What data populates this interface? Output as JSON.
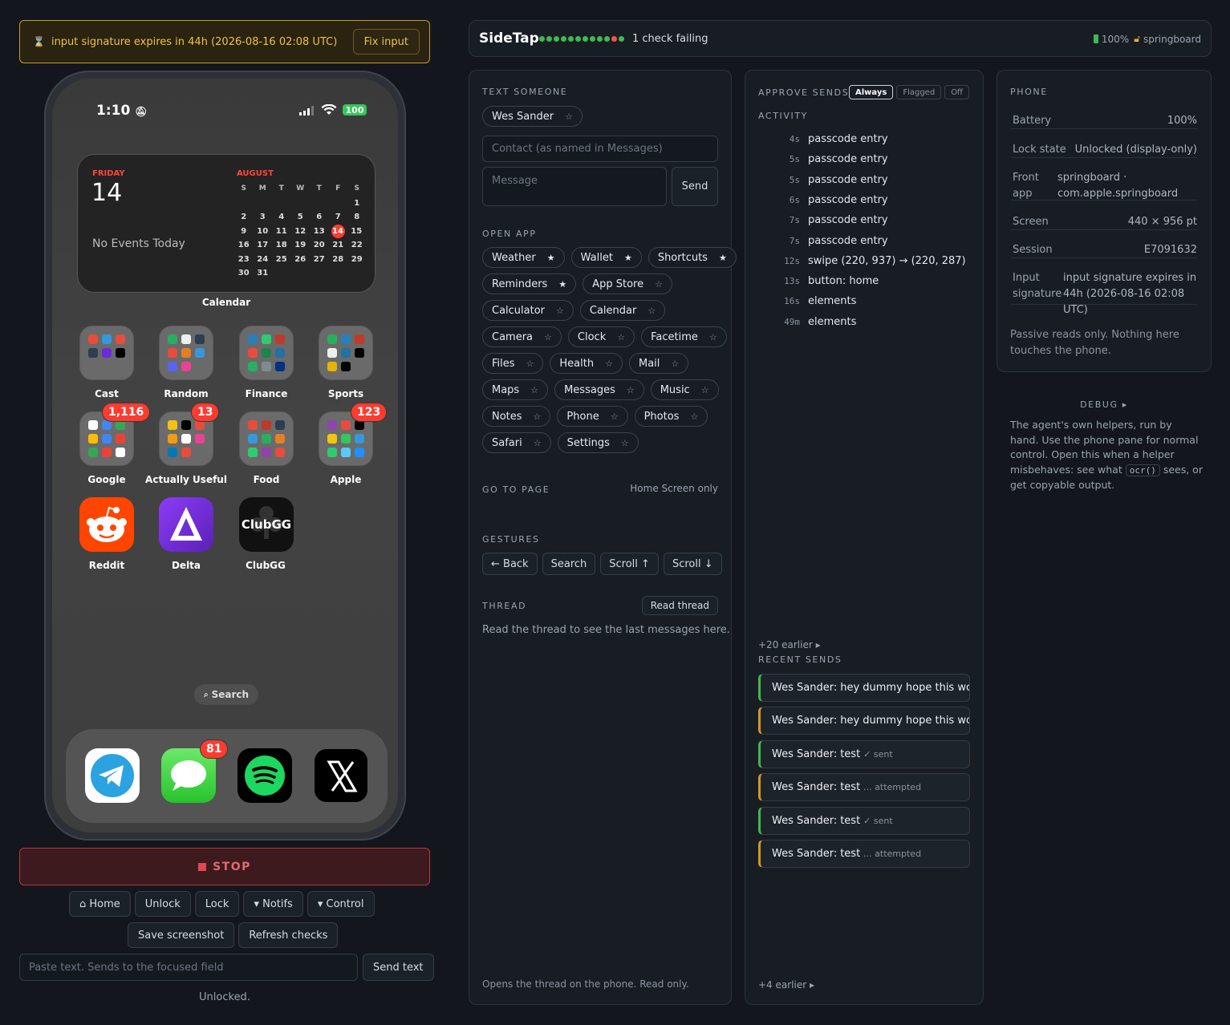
{
  "banner": {
    "icon": "hourglass-icon",
    "text": "input signature expires in 44h (2026-08-16 02:08 UTC)",
    "fix_label": "Fix input"
  },
  "phone": {
    "time": "1:10",
    "battery": "100",
    "calendar_widget": {
      "day": "FRIDAY",
      "date": "14",
      "no_events": "No Events Today",
      "month": "AUGUST",
      "weekdays": [
        "S",
        "M",
        "T",
        "W",
        "T",
        "F",
        "S"
      ],
      "weeks": [
        [
          "",
          "",
          "",
          "",
          "",
          "",
          "1"
        ],
        [
          "2",
          "3",
          "4",
          "5",
          "6",
          "7",
          "8"
        ],
        [
          "9",
          "10",
          "11",
          "12",
          "13",
          "14",
          "15"
        ],
        [
          "16",
          "17",
          "18",
          "19",
          "20",
          "21",
          "22"
        ],
        [
          "23",
          "24",
          "25",
          "26",
          "27",
          "28",
          "29"
        ],
        [
          "30",
          "31",
          "",
          "",
          "",
          "",
          ""
        ]
      ],
      "today": "14",
      "label": "Calendar"
    },
    "apps_row1": [
      "Cast",
      "Random",
      "Finance",
      "Sports"
    ],
    "apps_row2": [
      "Google",
      "Actually Useful",
      "Food",
      "Apple"
    ],
    "badges_row2": [
      "1,116",
      "13",
      "",
      "123"
    ],
    "apps_row3": [
      "Reddit",
      "Delta",
      "ClubGG"
    ],
    "clubgg_logo": "ClubGG",
    "search": "Search",
    "dock_badge": "81",
    "dock": [
      "telegram-icon",
      "messages-icon",
      "spotify-icon",
      "x-icon"
    ]
  },
  "stop_label": "STOP",
  "controls": {
    "home": "⌂ Home",
    "unlock": "Unlock",
    "lock": "Lock",
    "notifs": "▾ Notifs",
    "control": "▾ Control",
    "save_screenshot": "Save screenshot",
    "refresh_checks": "Refresh checks",
    "paste_placeholder": "Paste text. Sends to the focused field",
    "send_text": "Send text",
    "status": "Unlocked."
  },
  "topbar": {
    "title": "SideTap",
    "checks_text": "1 check failing",
    "battery": "100%",
    "app": "springboard",
    "check_dots": [
      "#3fb950",
      "#3fb950",
      "#3fb950",
      "#3fb950",
      "#3fb950",
      "#3fb950",
      "#3fb950",
      "#3fb950",
      "#3fb950",
      "#3fb950",
      "#f85149",
      "#3fb950"
    ]
  },
  "text_someone": {
    "label": "TEXT SOMEONE",
    "contact_chip": "Wes Sander",
    "contact_placeholder": "Contact (as named in Messages)",
    "message_placeholder": "Message",
    "send": "Send"
  },
  "open_app": {
    "label": "OPEN APP",
    "rows": [
      [
        {
          "name": "Weather",
          "fav": true
        },
        {
          "name": "Wallet",
          "fav": true
        },
        {
          "name": "Shortcuts",
          "fav": true
        }
      ],
      [
        {
          "name": "Reminders",
          "fav": true
        },
        {
          "name": "App Store",
          "fav": false
        }
      ],
      [
        {
          "name": "Calculator",
          "fav": false
        },
        {
          "name": "Calendar",
          "fav": false
        }
      ],
      [
        {
          "name": "Camera",
          "fav": false
        },
        {
          "name": "Clock",
          "fav": false
        },
        {
          "name": "Facetime",
          "fav": false
        }
      ],
      [
        {
          "name": "Files",
          "fav": false
        },
        {
          "name": "Health",
          "fav": false
        },
        {
          "name": "Mail",
          "fav": false
        }
      ],
      [
        {
          "name": "Maps",
          "fav": false
        },
        {
          "name": "Messages",
          "fav": false
        },
        {
          "name": "Music",
          "fav": false
        }
      ],
      [
        {
          "name": "Notes",
          "fav": false
        },
        {
          "name": "Phone",
          "fav": false
        },
        {
          "name": "Photos",
          "fav": false
        }
      ],
      [
        {
          "name": "Safari",
          "fav": false
        },
        {
          "name": "Settings",
          "fav": false
        }
      ]
    ]
  },
  "go_to_page": {
    "label": "GO TO PAGE",
    "hint": "Home Screen only"
  },
  "gestures": {
    "label": "GESTURES",
    "buttons": [
      "← Back",
      "Search",
      "Scroll ↑",
      "Scroll ↓"
    ]
  },
  "thread": {
    "label": "THREAD",
    "read_button": "Read thread",
    "placeholder": "Read the thread to see the last messages here.",
    "footer": "Opens the thread on the phone. Read only."
  },
  "approve": {
    "label": "APPROVE SENDS",
    "options": [
      "Always",
      "Flagged",
      "Off"
    ],
    "selected": "Always",
    "activity_label": "ACTIVITY",
    "activity": [
      {
        "t": "4s",
        "e": "passcode entry"
      },
      {
        "t": "5s",
        "e": "passcode entry"
      },
      {
        "t": "5s",
        "e": "passcode entry"
      },
      {
        "t": "6s",
        "e": "passcode entry"
      },
      {
        "t": "7s",
        "e": "passcode entry"
      },
      {
        "t": "7s",
        "e": "passcode entry"
      },
      {
        "t": "12s",
        "e": "swipe (220, 937) → (220, 287)"
      },
      {
        "t": "13s",
        "e": "button: home"
      },
      {
        "t": "16s",
        "e": "elements"
      },
      {
        "t": "49m",
        "e": "elements"
      }
    ],
    "earlier_top": "+20 earlier ▸",
    "recent_label": "RECENT SENDS",
    "recent": [
      {
        "who": "Wes Sander:",
        "msg": "hey dummy hope this work...",
        "status": "",
        "color": "#3fb950"
      },
      {
        "who": "Wes Sander:",
        "msg": "hey dummy hope this work...",
        "status": "",
        "color": "#d29922"
      },
      {
        "who": "Wes Sander:",
        "msg": "test",
        "status": "✓ sent",
        "color": "#3fb950"
      },
      {
        "who": "Wes Sander:",
        "msg": "test",
        "status": "... attempted",
        "color": "#d29922"
      },
      {
        "who": "Wes Sander:",
        "msg": "test",
        "status": "✓ sent",
        "color": "#3fb950"
      },
      {
        "who": "Wes Sander:",
        "msg": "test",
        "status": "... attempted",
        "color": "#d29922"
      }
    ],
    "earlier_bottom": "+4 earlier ▸"
  },
  "phone_info": {
    "label": "PHONE",
    "rows": [
      {
        "k": "Battery",
        "v": "100%"
      },
      {
        "k": "Lock state",
        "v": "Unlocked (display-only)"
      },
      {
        "k": "Front app",
        "v": "springboard · com.apple.springboard"
      },
      {
        "k": "Screen",
        "v": "440 × 956 pt"
      },
      {
        "k": "Session",
        "v": "E7091632"
      },
      {
        "k": "Input signature",
        "v": "input signature expires in 44h (2026-08-16 02:08 UTC)"
      }
    ],
    "note": "Passive reads only. Nothing here touches the phone."
  },
  "debug": {
    "label": "DEBUG ▸",
    "text_before": "The agent's own helpers, run by hand. Use the phone pane for normal control. Open this when a helper misbehaves: see what",
    "code": "ocr()",
    "text_after": "sees, or get copyable output."
  }
}
